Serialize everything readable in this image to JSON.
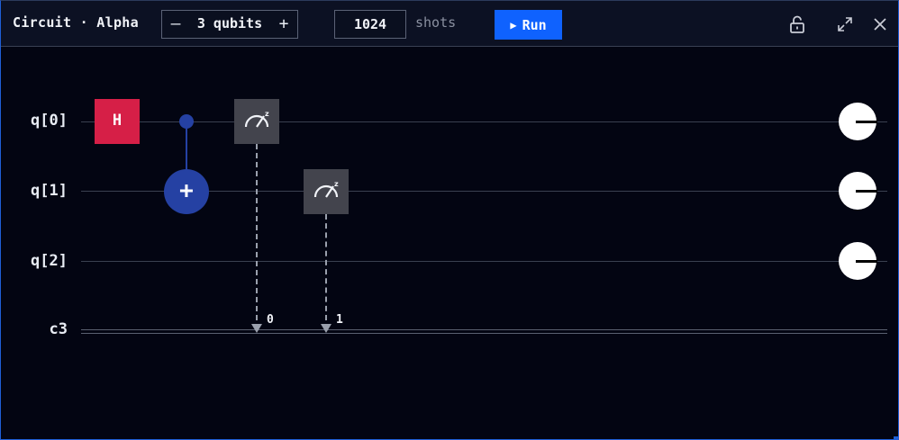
{
  "window": {
    "title": "Circuit · Alpha",
    "qubits_label": "3 qubits",
    "minus_symbol": "–",
    "plus_symbol": "+",
    "shots_value": "1024",
    "shots_label": "shots",
    "run_label": "Run",
    "icons": [
      "unlock-icon",
      "expand-icon",
      "close-icon"
    ]
  },
  "circuit": {
    "wire_labels": [
      "q[0]",
      "q[1]",
      "q[2]",
      "c3"
    ],
    "gates": {
      "hadamard": "H",
      "cnot_target": "+"
    },
    "measure_bits": [
      "0",
      "1"
    ]
  },
  "colors": {
    "hadamard": "#d61f47",
    "cnot": "#2541a3",
    "measure": "#43444d",
    "run": "#0f62fe"
  }
}
